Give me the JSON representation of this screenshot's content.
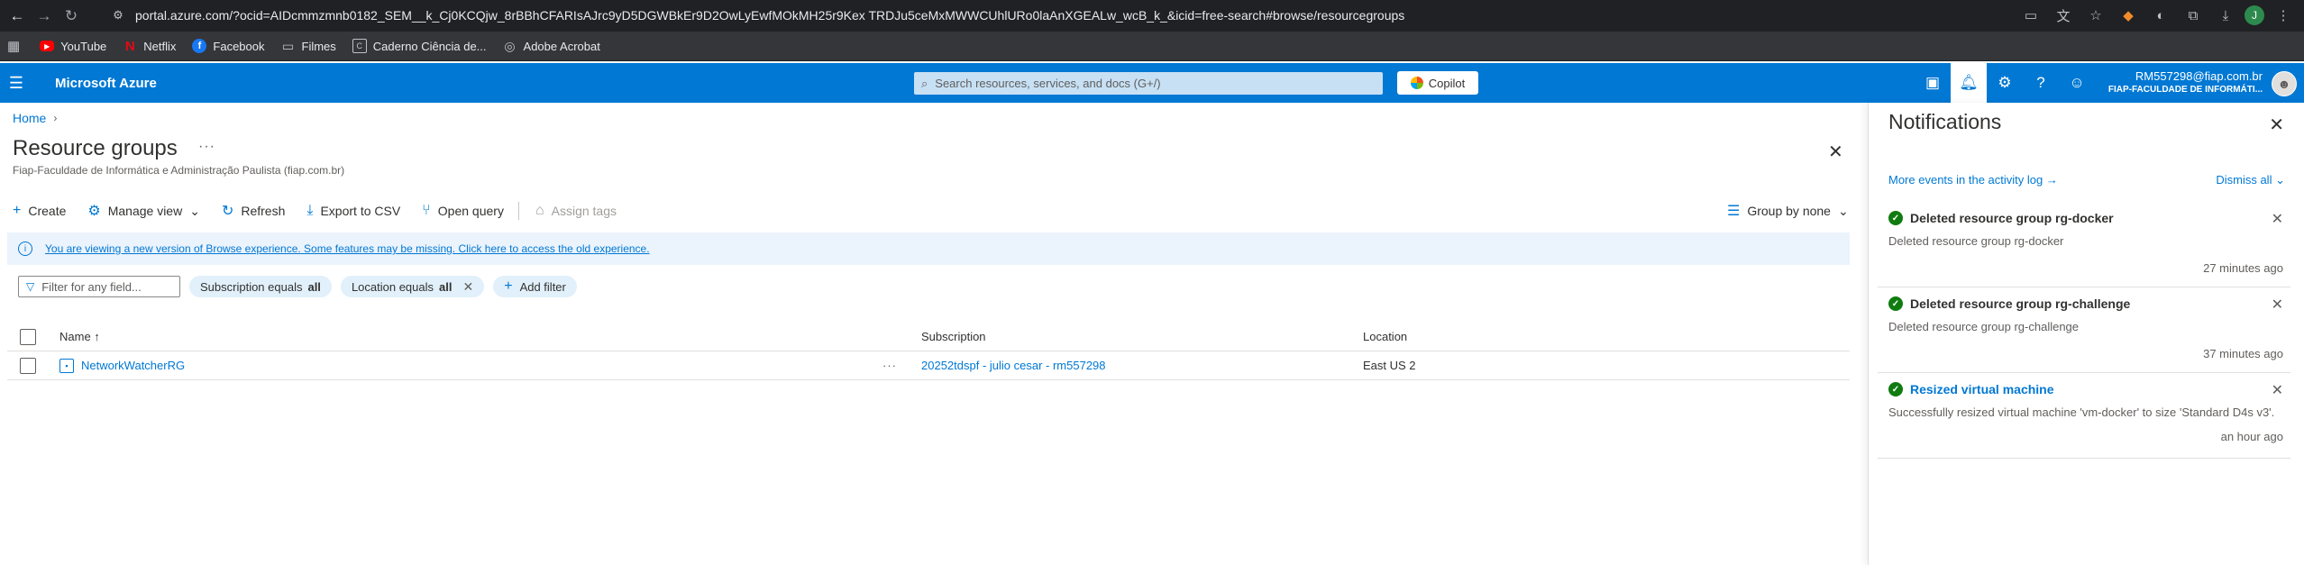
{
  "browser": {
    "url": "portal.azure.com/?ocid=AIDcmmzmnb0182_SEM__k_Cj0KCQjw_8rBBhCFARIsAJrc9yD5DGWBkEr9D2OwLyEwfMOkMH25r9Kex TRDJu5ceMxMWWCUhlURo0laAnXGEALw_wcB_k_&icid=free-search#browse/resourcegroups",
    "profile_initial": "J",
    "bookmarks": [
      "YouTube",
      "Netflix",
      "Facebook",
      "Filmes",
      "Caderno Ciência de...",
      "Adobe Acrobat"
    ]
  },
  "azure": {
    "brand": "Microsoft Azure",
    "search_placeholder": "Search resources, services, and docs (G+/)",
    "copilot_label": "Copilot",
    "account_email": "RM557298@fiap.com.br",
    "account_tenant": "FIAP-FACULDADE DE INFORMÁTI..."
  },
  "page": {
    "breadcrumb_home": "Home",
    "title": "Resource groups",
    "subtitle": "Fiap-Faculdade de Informática e Administração Paulista (fiap.com.br)",
    "toolbar": {
      "create": "Create",
      "manage_view": "Manage view",
      "refresh": "Refresh",
      "export_csv": "Export to CSV",
      "open_query": "Open query",
      "assign_tags": "Assign tags",
      "group_by": "Group by none"
    },
    "banner": "You are viewing a new version of Browse experience. Some features may be missing. Click here to access the old experience.",
    "filters": {
      "placeholder": "Filter for any field...",
      "subscription_label": "Subscription equals",
      "subscription_value": "all",
      "location_label": "Location equals",
      "location_value": "all",
      "add_filter": "Add filter"
    },
    "table": {
      "headers": {
        "name": "Name ↑",
        "subscription": "Subscription",
        "location": "Location"
      },
      "rows": [
        {
          "name": "NetworkWatcherRG",
          "subscription": "20252tdspf - julio cesar - rm557298",
          "location": "East US 2"
        }
      ]
    }
  },
  "notifications": {
    "title": "Notifications",
    "activity_link": "More events in the activity log →",
    "dismiss_all": "Dismiss all",
    "items": [
      {
        "title": "Deleted resource group rg-docker",
        "body": "Deleted resource group rg-docker",
        "time": "27 minutes ago"
      },
      {
        "title": "Deleted resource group rg-challenge",
        "body": "Deleted resource group rg-challenge",
        "time": "37 minutes ago"
      },
      {
        "title": "Resized virtual machine",
        "body": "Successfully resized virtual machine 'vm-docker' to size 'Standard D4s v3'.",
        "time": "an hour ago"
      }
    ]
  },
  "colors": {
    "azure_blue": "#0078d4",
    "success_green": "#107c10",
    "browser_dark": "#202124"
  }
}
